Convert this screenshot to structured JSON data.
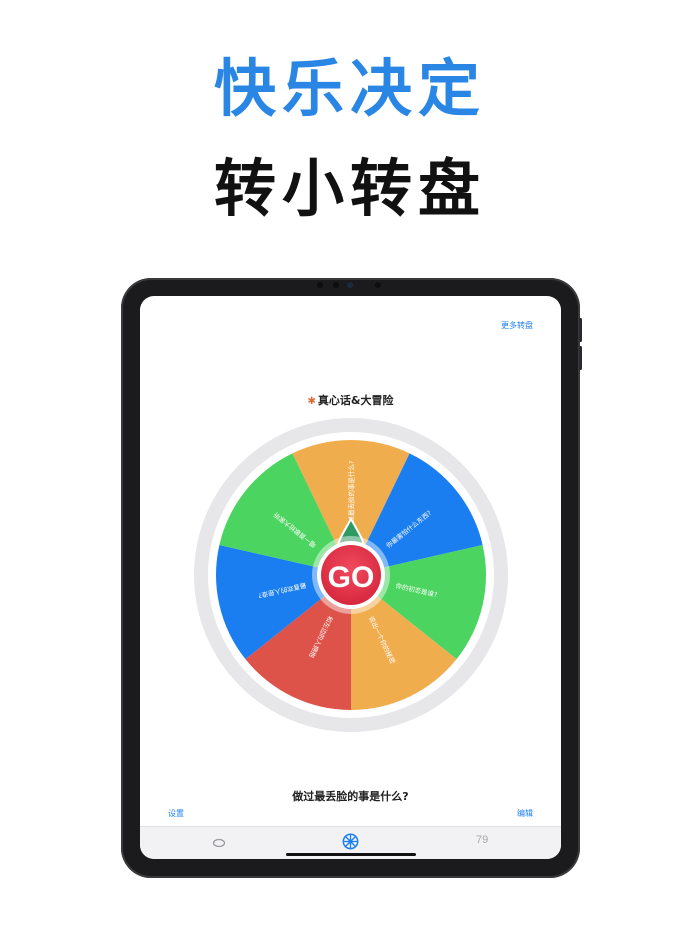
{
  "headline": {
    "line1": "快乐决定",
    "line2": "转小转盘"
  },
  "screen": {
    "more_wheels": "更多转盘",
    "wheel_title_icon": "🐝",
    "wheel_title": "真心话&大冒险",
    "go_label": "GO",
    "result_text": "做过最丢脸的事是什么?",
    "settings": "设置",
    "edit": "编辑"
  },
  "wheel": {
    "segments": [
      {
        "label": "做过最丢脸的事是什么?",
        "color": "#f0ad4e"
      },
      {
        "label": "你最害怕什么东西?",
        "color": "#1a7ef0"
      },
      {
        "label": "你的初恋是谁?",
        "color": "#4cd460"
      },
      {
        "label": "说出一个你的秘密",
        "color": "#f0ad4e"
      },
      {
        "label": "和左边的人拥抱",
        "color": "#dd5249"
      },
      {
        "label": "最喜欢的人是谁?",
        "color": "#1a7ef0"
      },
      {
        "label": "唱一首歌给大家听",
        "color": "#4cd460"
      }
    ]
  },
  "tabbar": {
    "tabs": [
      {
        "icon": "ring-icon",
        "active": false
      },
      {
        "icon": "wheel-icon",
        "active": true
      },
      {
        "icon": "number-icon",
        "label": "79",
        "active": false
      }
    ]
  },
  "colors": {
    "accent_blue": "#2a86e5",
    "go_red": "#e8354a",
    "pointer_green": "#2f9a64"
  }
}
